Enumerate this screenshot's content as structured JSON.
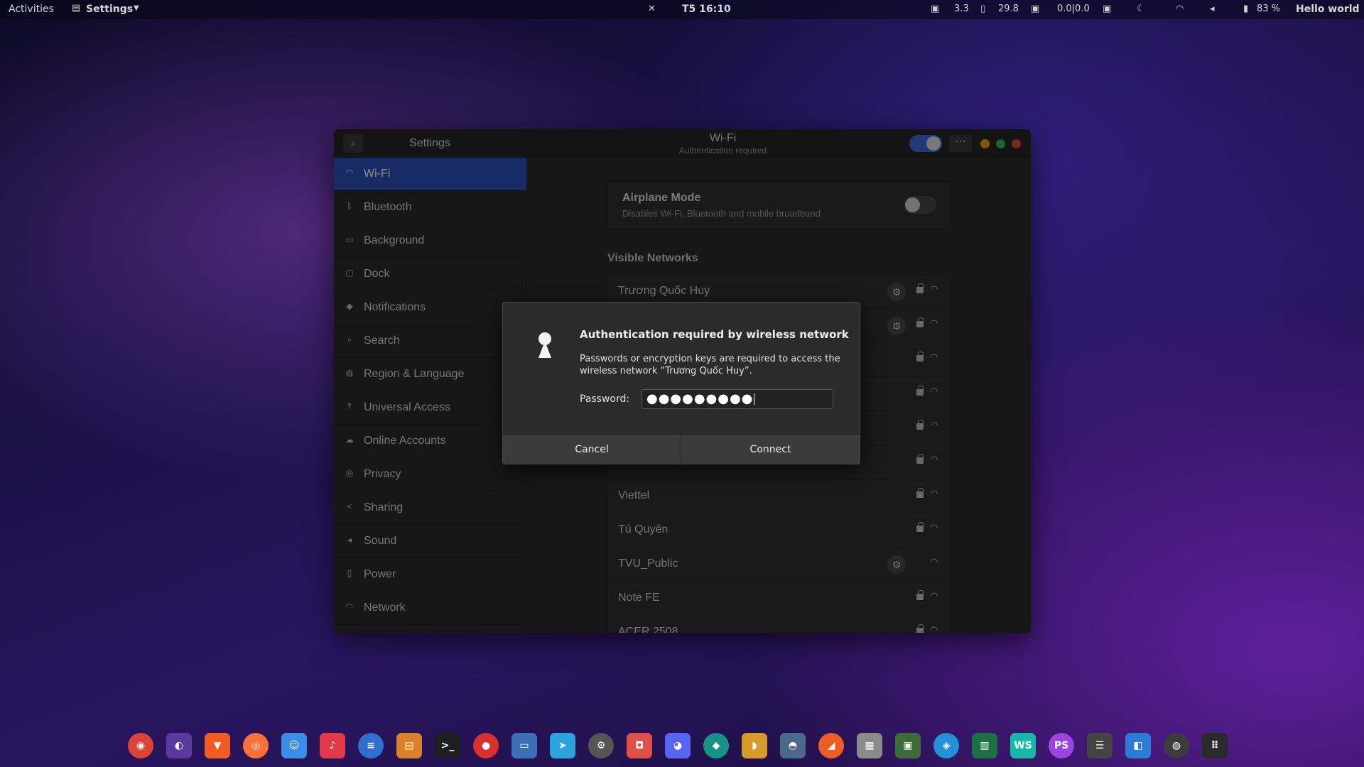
{
  "topbar": {
    "activities": "Activities",
    "app_menu": "Settings",
    "clock": "T5 16:10",
    "cpu": "3.3",
    "mem": "29.8",
    "net": "0.0|0.0",
    "battery": "83 %",
    "greeting": "Hello world"
  },
  "window": {
    "sidebar_title": "Settings",
    "panel_title": "Wi-Fi",
    "panel_subtitle": "Authentication required",
    "wifi_enabled": true
  },
  "sidebar": {
    "items": [
      {
        "label": "Wi-Fi",
        "icon": "wifi-icon",
        "active": true
      },
      {
        "label": "Bluetooth",
        "icon": "bluetooth-icon"
      },
      {
        "label": "Background",
        "icon": "background-icon"
      },
      {
        "label": "Dock",
        "icon": "dock-icon"
      },
      {
        "label": "Notifications",
        "icon": "notifications-icon"
      },
      {
        "label": "Search",
        "icon": "search-icon"
      },
      {
        "label": "Region & Language",
        "icon": "globe-icon"
      },
      {
        "label": "Universal Access",
        "icon": "accessibility-icon"
      },
      {
        "label": "Online Accounts",
        "icon": "cloud-icon"
      },
      {
        "label": "Privacy",
        "icon": "privacy-icon"
      },
      {
        "label": "Sharing",
        "icon": "share-icon"
      },
      {
        "label": "Sound",
        "icon": "sound-icon"
      },
      {
        "label": "Power",
        "icon": "power-icon"
      },
      {
        "label": "Network",
        "icon": "network-icon"
      }
    ]
  },
  "airplane": {
    "title": "Airplane Mode",
    "description": "Disables Wi-Fi, Bluetooth and mobile broadband",
    "enabled": false
  },
  "networks": {
    "heading": "Visible Networks",
    "items": [
      {
        "name": "Trương Quốc Huy",
        "gear": true,
        "lock": true
      },
      {
        "name": "",
        "gear": true,
        "lock": true
      },
      {
        "name": "",
        "gear": false,
        "lock": true
      },
      {
        "name": "",
        "gear": false,
        "lock": true
      },
      {
        "name": "",
        "gear": false,
        "lock": true
      },
      {
        "name": "",
        "gear": false,
        "lock": true
      },
      {
        "name": "Viettel",
        "gear": false,
        "lock": true
      },
      {
        "name": "Tú Quyên",
        "gear": false,
        "lock": true
      },
      {
        "name": "TVU_Public",
        "gear": true,
        "lock": false
      },
      {
        "name": "Note FE",
        "gear": false,
        "lock": true
      },
      {
        "name": "ACER 2508",
        "gear": false,
        "lock": true
      }
    ]
  },
  "dialog": {
    "title": "Authentication required by wireless network",
    "body": "Passwords or encryption keys are required to access the wireless network “Trương Quốc Huy”.",
    "password_label": "Password:",
    "password_masked": "●●●●●●●●●",
    "cancel_label": "Cancel",
    "connect_label": "Connect"
  },
  "dock": {
    "apps": [
      {
        "name": "chrome-icon",
        "glyph": "◉",
        "color": "#db4437"
      },
      {
        "name": "podcast-icon",
        "glyph": "◐",
        "color": "#5b3a9e"
      },
      {
        "name": "brave-icon",
        "glyph": "▼",
        "color": "#f25b22"
      },
      {
        "name": "firefox-icon",
        "glyph": "◎",
        "color": "#ff7139"
      },
      {
        "name": "finder-icon",
        "glyph": "☺",
        "color": "#3a8ee6"
      },
      {
        "name": "music-icon",
        "glyph": "♪",
        "color": "#e2394b"
      },
      {
        "name": "text-editor-icon",
        "glyph": "≡",
        "color": "#2f6fd0"
      },
      {
        "name": "archive-icon",
        "glyph": "▤",
        "color": "#d9822b"
      },
      {
        "name": "terminal-icon",
        "glyph": ">_",
        "color": "#1e1e1e"
      },
      {
        "name": "record-icon",
        "glyph": "●",
        "color": "#d8302f"
      },
      {
        "name": "window-icon",
        "glyph": "▭",
        "color": "#3b6fb6"
      },
      {
        "name": "telegram-icon",
        "glyph": "➤",
        "color": "#2aa3de"
      },
      {
        "name": "settings-icon",
        "glyph": "⚙",
        "color": "#555555"
      },
      {
        "name": "screenshot-icon",
        "glyph": "◘",
        "color": "#e0504a"
      },
      {
        "name": "discord-icon",
        "glyph": "◕",
        "color": "#5865f2"
      },
      {
        "name": "gitkraken-icon",
        "glyph": "◆",
        "color": "#179287"
      },
      {
        "name": "dbeaver-icon",
        "glyph": "◗",
        "color": "#d49a2a"
      },
      {
        "name": "mysql-icon",
        "glyph": "◓",
        "color": "#4a6a8a"
      },
      {
        "name": "postman-icon",
        "glyph": "◢",
        "color": "#ef5b25"
      },
      {
        "name": "notes-icon",
        "glyph": "▦",
        "color": "#8a8a8a"
      },
      {
        "name": "book-icon",
        "glyph": "▣",
        "color": "#3d6b3a"
      },
      {
        "name": "cube-icon",
        "glyph": "◈",
        "color": "#2390d8"
      },
      {
        "name": "excel-icon",
        "glyph": "▥",
        "color": "#1d6f42"
      },
      {
        "name": "webstorm-icon",
        "glyph": "WS",
        "color": "#16b8a8"
      },
      {
        "name": "phpstorm-icon",
        "glyph": "PS",
        "color": "#9b45e0"
      },
      {
        "name": "menu-bars-icon",
        "glyph": "☰",
        "color": "#444444"
      },
      {
        "name": "vscode-icon",
        "glyph": "◧",
        "color": "#2e7bd6"
      },
      {
        "name": "gnome-settings-icon",
        "glyph": "◍",
        "color": "#3c3c3c"
      },
      {
        "name": "app-grid-icon",
        "glyph": "⠿",
        "color": "#2a2a2a"
      }
    ]
  }
}
